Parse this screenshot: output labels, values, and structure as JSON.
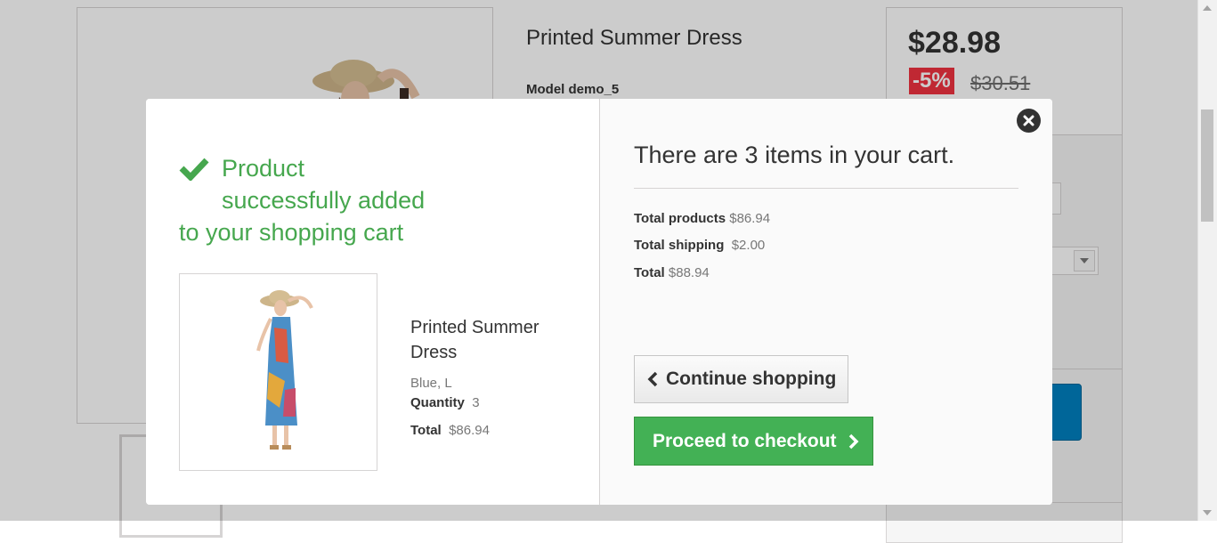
{
  "background": {
    "product_title": "Printed Summer Dress",
    "model_label": "Model demo_5",
    "price": "$28.98",
    "discount": "-5%",
    "old_price": "$30.51"
  },
  "modal": {
    "success_line1": "Product",
    "success_line2": "successfully added",
    "success_line3": "to your shopping cart",
    "product": {
      "name": "Printed Summer Dress",
      "attributes": "Blue, L",
      "quantity_label": "Quantity",
      "quantity_value": "3",
      "total_label": "Total",
      "total_value": "$86.94"
    },
    "cart": {
      "count_text": "There are 3 items in your cart.",
      "total_products_label": "Total products",
      "total_products_value": "$86.94",
      "total_shipping_label": "Total shipping",
      "total_shipping_value": "$2.00",
      "total_label": "Total",
      "total_value": "$88.94"
    },
    "continue_label": "Continue shopping",
    "checkout_label": "Proceed to checkout"
  },
  "colors": {
    "success_green": "#46a74e",
    "checkout_green": "#43b155",
    "discount_red": "#f13340"
  },
  "icons": [
    "check-icon",
    "close-icon",
    "chevron-left-icon",
    "chevron-right-icon"
  ]
}
